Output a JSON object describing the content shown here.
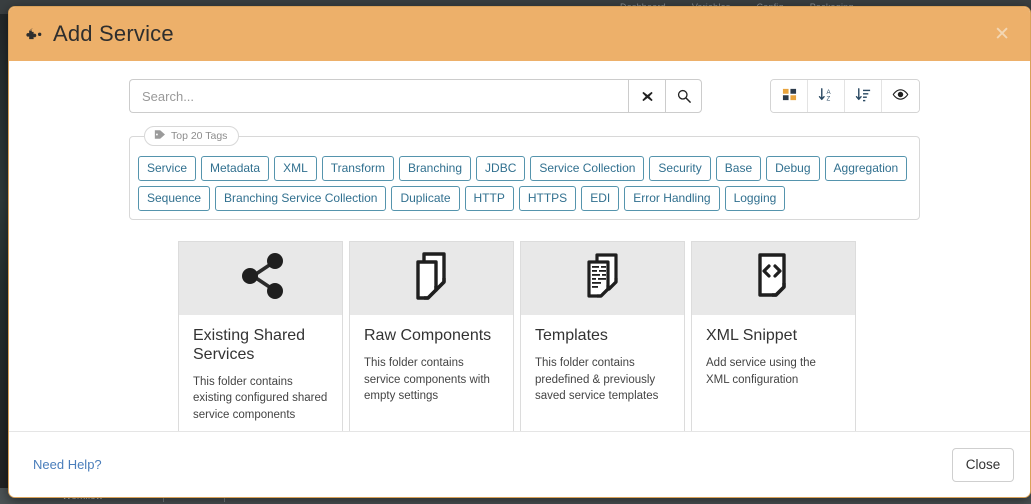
{
  "background": {
    "toolbar_items": [
      "Dashboard",
      "Variables",
      "Config",
      "Packaging"
    ],
    "bottom_tab_label": "Workflow"
  },
  "modal": {
    "title": "Add Service",
    "title_icon": "puzzle-piece-icon",
    "close_icon": "close-icon"
  },
  "search": {
    "placeholder": "Search...",
    "value": "",
    "clear_icon": "clear-x-icon",
    "submit_icon": "search-icon"
  },
  "view_toolbar": {
    "buttons": [
      {
        "name": "grid-view-button",
        "icon": "th-large-icon"
      },
      {
        "name": "sort-alpha-button",
        "icon": "sort-alpha-down-icon"
      },
      {
        "name": "sort-amount-button",
        "icon": "sort-amount-down-icon"
      },
      {
        "name": "toggle-visibility-button",
        "icon": "eye-icon"
      }
    ]
  },
  "tags_panel": {
    "legend": "Top 20 Tags",
    "legend_icon": "tag-icon",
    "tags": [
      "Service",
      "Metadata",
      "XML",
      "Transform",
      "Branching",
      "JDBC",
      "Service Collection",
      "Security",
      "Base",
      "Debug",
      "Aggregation",
      "Sequence",
      "Branching Service Collection",
      "Duplicate",
      "HTTP",
      "HTTPS",
      "EDI",
      "Error Handling",
      "Logging"
    ]
  },
  "cards": [
    {
      "icon": "share-alt-icon",
      "title": "Existing Shared Services",
      "description": "This folder contains existing configured shared service components"
    },
    {
      "icon": "copy-documents-icon",
      "title": "Raw Components",
      "description": "This folder contains service components with empty settings"
    },
    {
      "icon": "document-template-icon",
      "title": "Templates",
      "description": "This folder contains predefined & previously saved service templates"
    },
    {
      "icon": "code-document-icon",
      "title": "XML Snippet",
      "description": "Add service using the XML configuration"
    }
  ],
  "footer": {
    "help_link": "Need Help?",
    "close_label": "Close"
  },
  "colors": {
    "header_orange": "#edb06a",
    "tag_teal": "#31708f",
    "link_blue": "#4a7ebb",
    "card_icon_bg": "#e8e8e8"
  }
}
